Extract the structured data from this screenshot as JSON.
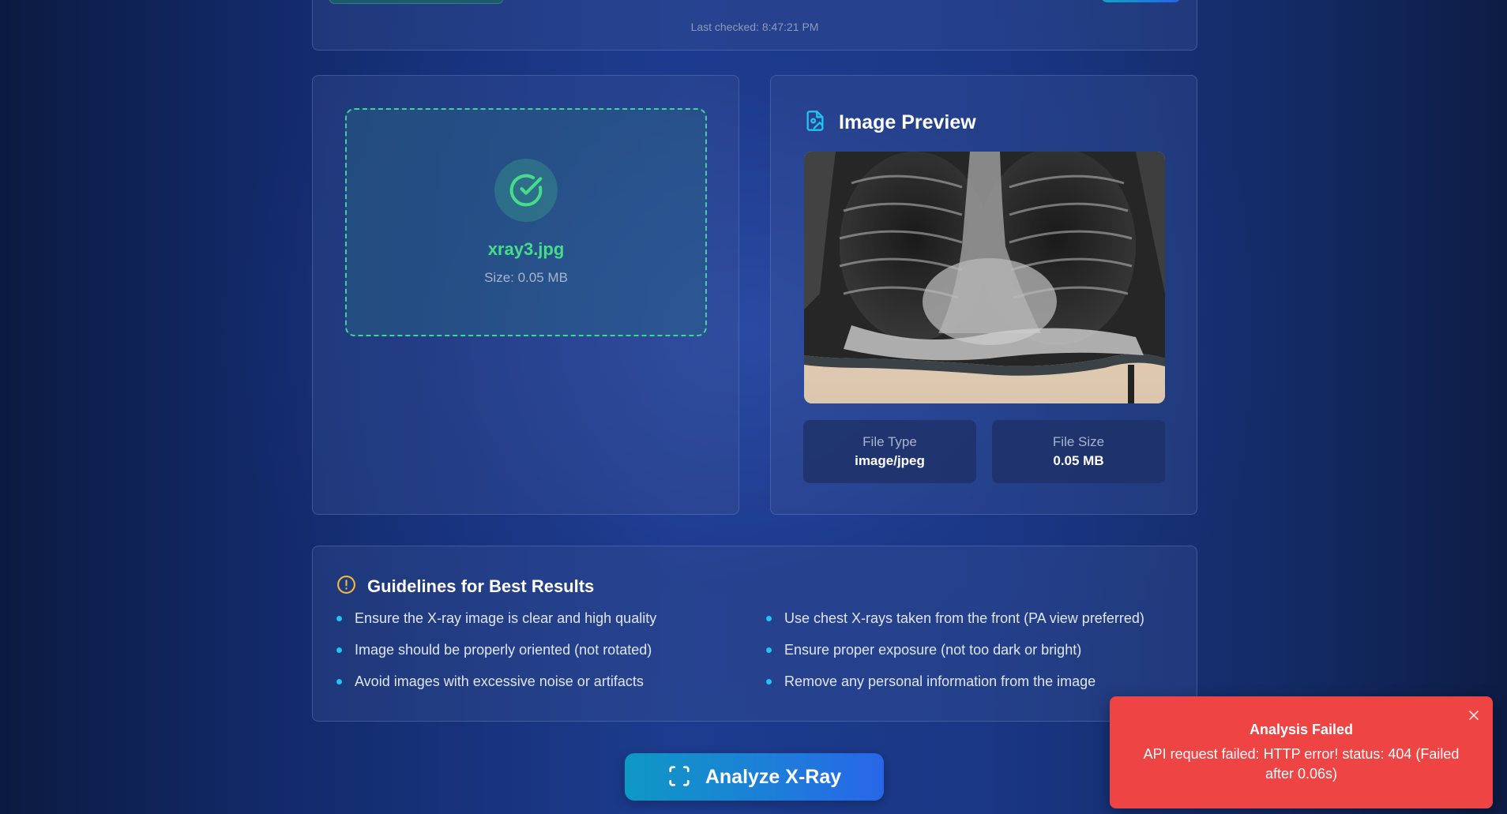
{
  "status": {
    "last_checked": "Last checked: 8:47:21 PM"
  },
  "upload": {
    "file_name": "xray3.jpg",
    "file_size": "Size: 0.05 MB",
    "status_icon": "check-circle-icon"
  },
  "preview": {
    "title": "Image Preview",
    "title_icon": "image-file-icon",
    "file_type_label": "File Type",
    "file_type_value": "image/jpeg",
    "file_size_label": "File Size",
    "file_size_value": "0.05 MB"
  },
  "guidelines": {
    "title": "Guidelines for Best Results",
    "title_icon": "alert-circle-icon",
    "left": [
      "Ensure the X-ray image is clear and high quality",
      "Image should be properly oriented (not rotated)",
      "Avoid images with excessive noise or artifacts"
    ],
    "right": [
      "Use chest X-rays taken from the front (PA view preferred)",
      "Ensure proper exposure (not too dark or bright)",
      "Remove any personal information from the image"
    ]
  },
  "actions": {
    "analyze_label": "Analyze X-Ray",
    "analyze_icon": "scan-icon"
  },
  "toast": {
    "title": "Analysis Failed",
    "message": "API request failed: HTTP error! status: 404 (Failed after 0.06s)",
    "close_icon": "close-icon"
  },
  "colors": {
    "success": "#46dc8a",
    "accent": "#22c3ee",
    "warning": "#f5b83d",
    "error": "#ef4444"
  }
}
